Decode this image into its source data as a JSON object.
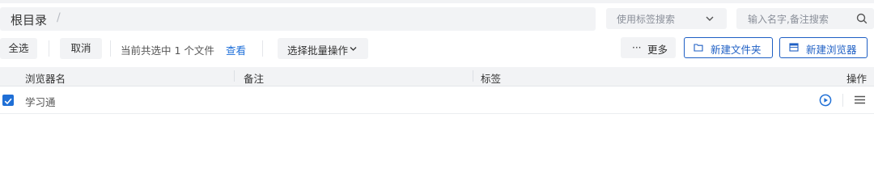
{
  "breadcrumb": {
    "root": "根目录",
    "separator": "/"
  },
  "tag_search": {
    "placeholder": "使用标签搜索"
  },
  "search": {
    "placeholder": "输入名字,备注搜索"
  },
  "toolbar": {
    "select_all": "全选",
    "cancel": "取消",
    "selection_info": "当前共选中 1 个文件",
    "view": "查看",
    "batch_ops": "选择批量操作",
    "more_dots": "···",
    "more": "更多",
    "new_folder": "新建文件夹",
    "new_browser": "新建浏览器"
  },
  "table": {
    "headers": {
      "name": "浏览器名",
      "note": "备注",
      "tags": "标签",
      "actions": "操作"
    },
    "rows": [
      {
        "name": "学习通",
        "note": "",
        "tags": "",
        "checked": true
      }
    ]
  },
  "colors": {
    "accent": "#1e5fc4",
    "link": "#1e6fd9",
    "checkbox": "#1f6fd6",
    "surface": "#f2f3f5"
  }
}
